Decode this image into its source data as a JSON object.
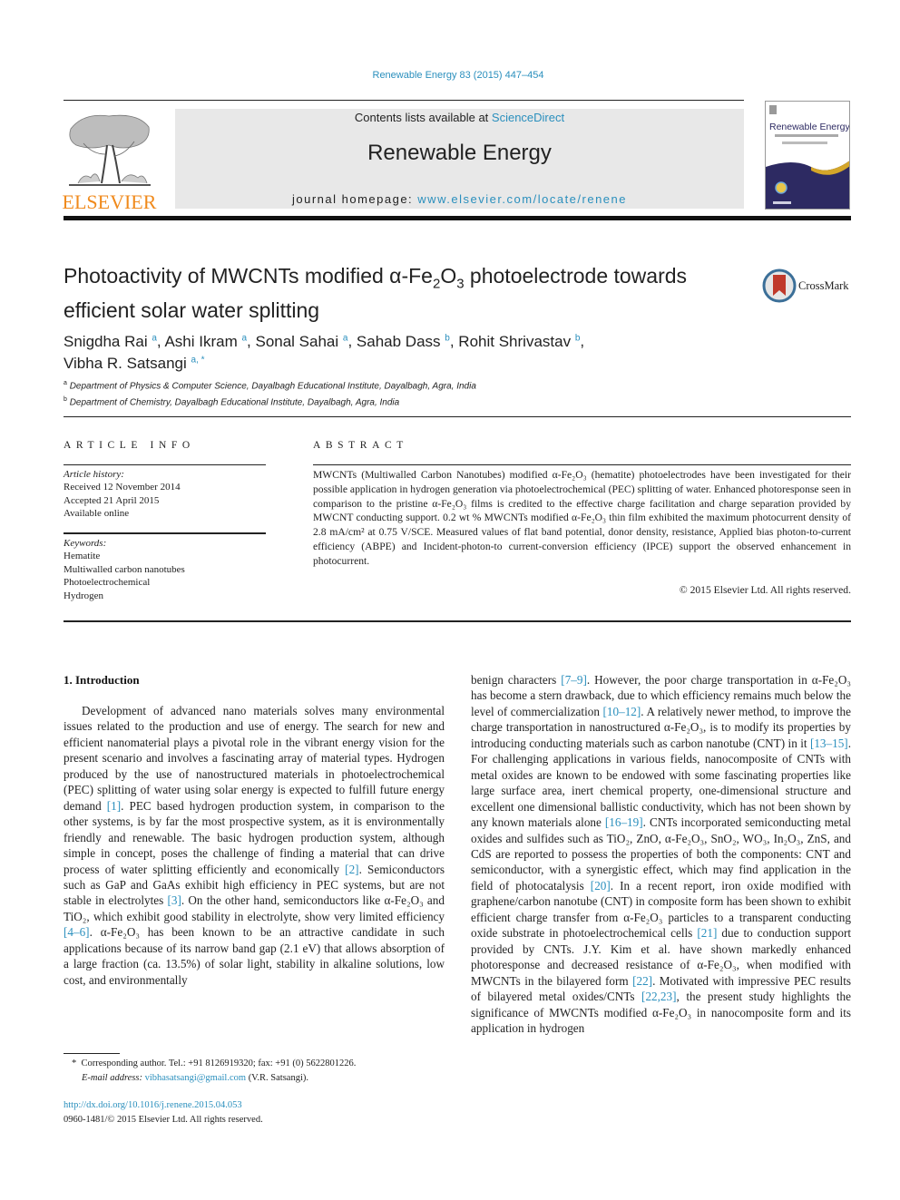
{
  "header": {
    "citation": "Renewable Energy 83 (2015) 447–454",
    "contents_prefix": "Contents lists available at ",
    "contents_link": "ScienceDirect",
    "journal_name": "Renewable Energy",
    "homepage_prefix": "journal homepage: ",
    "homepage_link": "www.elsevier.com/locate/renene",
    "publisher_logo_text": "ELSEVIER",
    "cover_title": "Renewable Energy",
    "brand_colors": {
      "link": "#2a8fbd",
      "elsevier_orange": "#f08a1c",
      "cover_navy": "#2d2a62",
      "cover_gold": "#d4a62a"
    }
  },
  "article": {
    "title_part1": "Photoactivity of MWCNTs modified α-Fe",
    "title_sub1": "2",
    "title_part2": "O",
    "title_sub2": "3",
    "title_part3": " photoelectrode towards efficient solar water splitting",
    "crossmark_label": "CrossMark",
    "authors": [
      {
        "name": "Snigdha Rai",
        "aff": "a"
      },
      {
        "name": "Ashi Ikram",
        "aff": "a"
      },
      {
        "name": "Sonal Sahai",
        "aff": "a"
      },
      {
        "name": "Sahab Dass",
        "aff": "b"
      },
      {
        "name": "Rohit Shrivastav",
        "aff": "b"
      },
      {
        "name": "Vibha R. Satsangi",
        "aff": "a, *"
      }
    ],
    "affiliations": [
      {
        "label": "a",
        "text": "Department of Physics & Computer Science, Dayalbagh Educational Institute, Dayalbagh, Agra, India"
      },
      {
        "label": "b",
        "text": "Department of Chemistry, Dayalbagh Educational Institute, Dayalbagh, Agra, India"
      }
    ]
  },
  "article_info": {
    "heading": "ARTICLE INFO",
    "history_label": "Article history:",
    "history": [
      "Received 12 November 2014",
      "Accepted 21 April 2015",
      "Available online"
    ],
    "keywords_label": "Keywords:",
    "keywords": [
      "Hematite",
      "Multiwalled carbon nanotubes",
      "Photoelectrochemical",
      "Hydrogen"
    ]
  },
  "abstract": {
    "heading": "ABSTRACT",
    "text": "MWCNTs (Multiwalled Carbon Nanotubes) modified α-Fe₂O₃ (hematite) photoelectrodes have been investigated for their possible application in hydrogen generation via photoelectrochemical (PEC) splitting of water. Enhanced photoresponse seen in comparison to the pristine α-Fe₂O₃ films is credited to the effective charge facilitation and charge separation provided by MWCNT conducting support. 0.2 wt % MWCNTs modified α-Fe₂O₃ thin film exhibited the maximum photocurrent density of 2.8 mA/cm² at 0.75 V/SCE. Measured values of flat band potential, donor density, resistance, Applied bias photon-to-current efficiency (ABPE) and Incident-photon-to current-conversion efficiency (IPCE) support the observed enhancement in photocurrent.",
    "copyright": "© 2015 Elsevier Ltd. All rights reserved."
  },
  "body": {
    "section_heading": "1.  Introduction",
    "left_column": [
      {
        "t": "Development of advanced nano materials solves many envi­ronmental issues related to the production and use of energy. The search for new and efficient nanomaterial plays a pivotal role in the vibrant energy vision for the present scenario and involves a fascinating array of material types. Hydrogen produced by the use of nanostructured materials in photoelectrochemical (PEC) splitting of water using solar energy is expected to fulfill future energy de­mand "
      },
      {
        "ref": "[1]"
      },
      {
        "t": ". PEC based hydrogen production system, in comparison to the other systems, is by far the most prospective system, as it is environmentally friendly and renewable. The basic hydrogen pro­duction system, although simple in concept, poses the challenge of finding a material that can drive process of water splitting effi­ciently and economically "
      },
      {
        "ref": "[2]"
      },
      {
        "t": ". Semiconductors such as GaP and GaAs exhibit high efficiency in PEC systems, but are not stable in elec­trolytes "
      },
      {
        "ref": "[3]"
      },
      {
        "t": ". On the other hand, semiconductors like α-Fe₂O₃ and TiO₂, which exhibit good stability in electrolyte, show very limited efficiency "
      },
      {
        "ref": "[4–6]"
      },
      {
        "t": ". α-Fe₂O₃ has been known to be an attractive candidate in such applications because of its narrow band gap (2.1 eV) that allows absorption of a large fraction (ca. 13.5%) of solar light, stability in alkaline solutions, low cost, and environmentally"
      }
    ],
    "right_column": [
      {
        "t": "benign characters "
      },
      {
        "ref": "[7–9]"
      },
      {
        "t": ". However, the poor charge transportation in α-Fe₂O₃ has become a stern drawback, due to which efficiency remains much below the level of commercialization "
      },
      {
        "ref": "[10–12]"
      },
      {
        "t": ". A relatively newer method, to improve the charge transportation in nanostructured α-Fe₂O₃, is to modify its properties by introducing conducting materials such as carbon nanotube (CNT) in it "
      },
      {
        "ref": "[13–15]"
      },
      {
        "t": ". For challenging applications in various fields, nanocomposite of CNTs with metal oxides are known to be endowed with some fascinating properties like large surface area, inert chemical prop­erty, one-dimensional structure and excellent one dimensional ballistic conductivity, which has not been shown by any known materials alone "
      },
      {
        "ref": "[16–19]"
      },
      {
        "t": ". CNTs incorporated semiconducting metal oxides and sulfides such as TiO₂, ZnO, α-Fe₂O₃, SnO₂, WO₃, In₂O₃, ZnS, and CdS are reported to possess the properties of both the components: CNT and semiconductor, with a synergistic effect, which may find application in the field of photocatalysis "
      },
      {
        "ref": "[20]"
      },
      {
        "t": ". In a recent report, iron oxide modified with graphene/carbon nanotube (CNT) in composite form has been shown to exhibit efficient charge transfer from α-Fe₂O₃ particles to a transparent conducting oxide substrate in photoelectrochemical cells "
      },
      {
        "ref": "[21]"
      },
      {
        "t": " due to conduction support provided by CNTs. J.Y. Kim et al. have shown markedly enhanced photoresponse and decreased resistance of α-Fe₂O₃, when modified with MWCNTs in the bilayered form "
      },
      {
        "ref": "[22]"
      },
      {
        "t": ". Motivated with impressive PEC results of bilayered metal oxides/CNTs "
      },
      {
        "ref": "[22,23]"
      },
      {
        "t": ", the present study highlights the significance of MWCNTs modified α-Fe₂O₃ in nanocomposite form and its application in hydrogen"
      }
    ]
  },
  "footnote": {
    "star": "*",
    "corresponding": "Corresponding author. Tel.: +91 8126919320; fax: +91 (0) 5622801226.",
    "email_label": "E-mail address:",
    "email": "vibhasatsangi@gmail.com",
    "email_suffix": " (V.R. Satsangi).",
    "doi": "http://dx.doi.org/10.1016/j.renene.2015.04.053",
    "issn": "0960-1481/© 2015 Elsevier Ltd. All rights reserved."
  }
}
